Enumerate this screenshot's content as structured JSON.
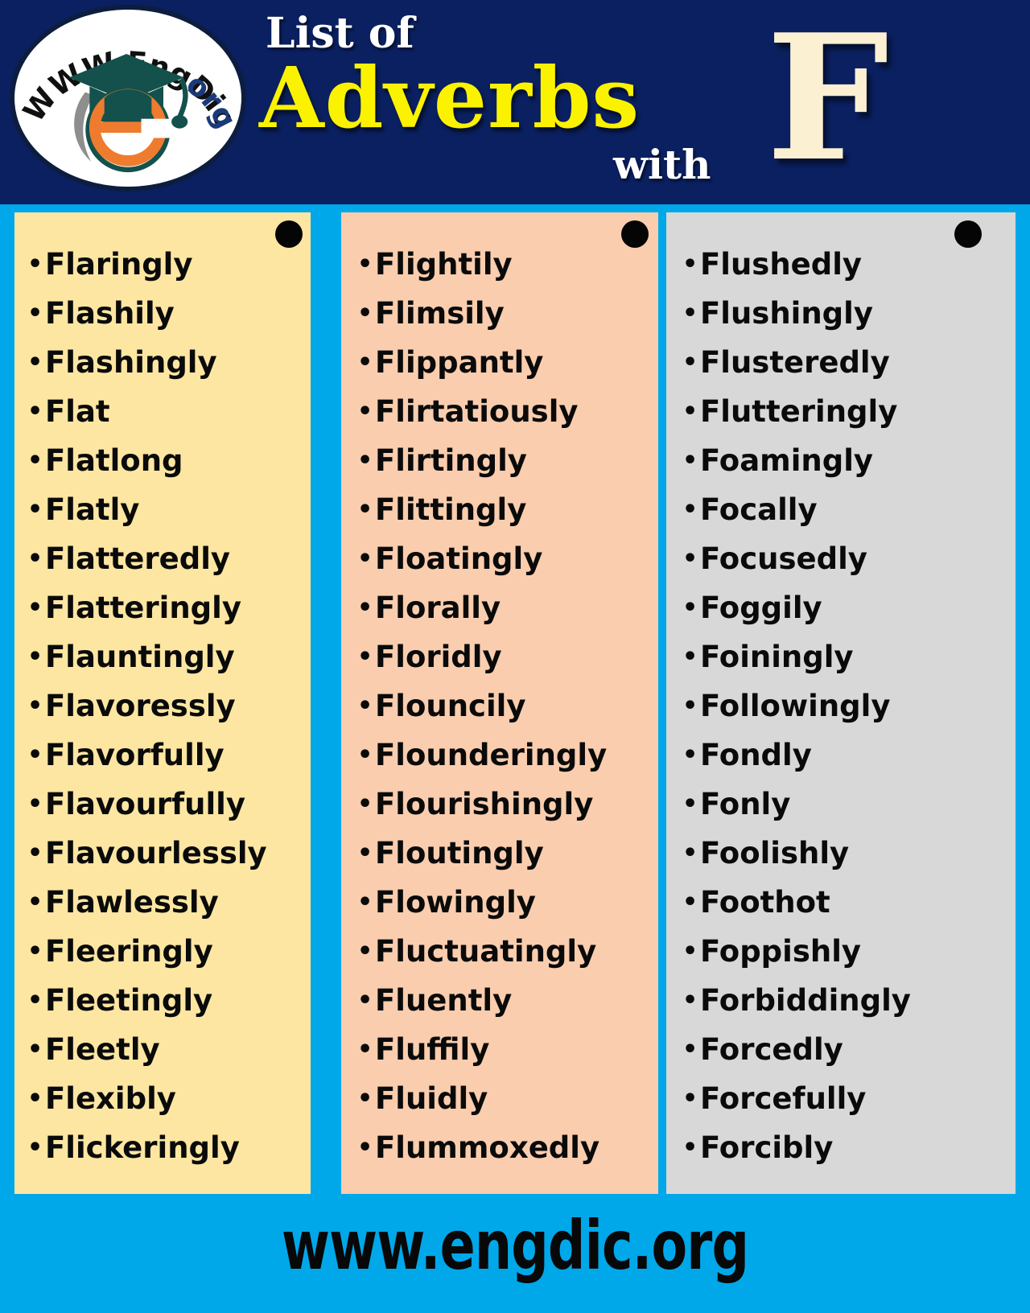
{
  "header": {
    "pretitle": "List of",
    "title": "Adverbs",
    "connector": "with",
    "letter": "F",
    "logo": {
      "text_top": "WWW.EngDic.",
      "text_end": "org",
      "full_text": "WWW.EngDic.org",
      "cap_color": "#14514c",
      "e_color": "#ef7b2f",
      "ring_color": "#0d1d3f"
    },
    "bg_color": "#0a2060",
    "title_color": "#fbf200",
    "letter_color": "#fcf0d2"
  },
  "page": {
    "bg_color": "#00a8ea",
    "bullet": "•"
  },
  "columns": [
    {
      "name": "column-1",
      "bg_color": "#fce6a2",
      "words": [
        "Flaringly",
        "Flashily",
        "Flashingly",
        "Flat",
        "Flatlong",
        "Flatly",
        "Flatteredly",
        "Flatteringly",
        "Flauntingly",
        "Flavoressly",
        "Flavorfully",
        "Flavourfully",
        "Flavourlessly",
        "Flawlessly",
        "Fleeringly",
        "Fleetingly",
        "Fleetly",
        "Flexibly",
        "Flickeringly"
      ]
    },
    {
      "name": "column-2",
      "bg_color": "#f9cdae",
      "words": [
        "Flightily",
        "Flimsily",
        "Flippantly",
        "Flirtatiously",
        "Flirtingly",
        "Flittingly",
        "Floatingly",
        "Florally",
        "Floridly",
        "Flouncily",
        "Flounderingly",
        "Flourishingly",
        "Floutingly",
        "Flowingly",
        "Fluctuatingly",
        "Fluently",
        "Fluffily",
        "Fluidly",
        "Flummoxedly"
      ]
    },
    {
      "name": "column-3",
      "bg_color": "#d8d8d8",
      "words": [
        "Flushedly",
        "Flushingly",
        "Flusteredly",
        "Flutteringly",
        "Foamingly",
        "Focally",
        "Focusedly",
        "Foggily",
        "Foiningly",
        "Followingly",
        "Fondly",
        "Fonly",
        "Foolishly",
        "Foothot",
        "Foppishly",
        "Forbiddingly",
        "Forcedly",
        "Forcefully",
        "Forcibly"
      ]
    }
  ],
  "footer": {
    "website": "www.engdic.org",
    "bg_color": "#00a8ea"
  }
}
